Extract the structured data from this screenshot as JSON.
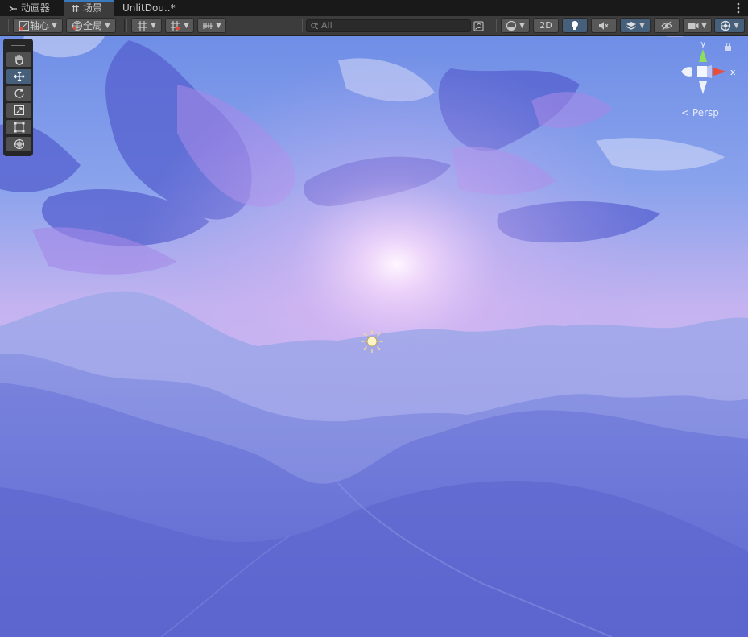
{
  "tabs": [
    {
      "label": "动画器",
      "icon": "animator-icon",
      "active": false
    },
    {
      "label": "场景",
      "icon": "scene-grid-icon",
      "active": true
    },
    {
      "label": "UnlitDou..*",
      "icon": null,
      "active": false
    }
  ],
  "toolbar": {
    "pivot_label": "轴心",
    "global_label": "全局",
    "search_placeholder": "All",
    "mode_2d_label": "2D"
  },
  "gizmo": {
    "y_label": "y",
    "x_label": "x",
    "projection_label": "Persp"
  },
  "tools": [
    "hand-tool",
    "move-tool",
    "rotate-tool",
    "scale-tool",
    "rect-tool",
    "transform-tool"
  ],
  "active_tool": "move-tool",
  "colors": {
    "accent": "#46607c",
    "tab_highlight": "#3a79bb",
    "toolbar_bg": "#3c3c3c",
    "tab_bg": "#191919"
  }
}
